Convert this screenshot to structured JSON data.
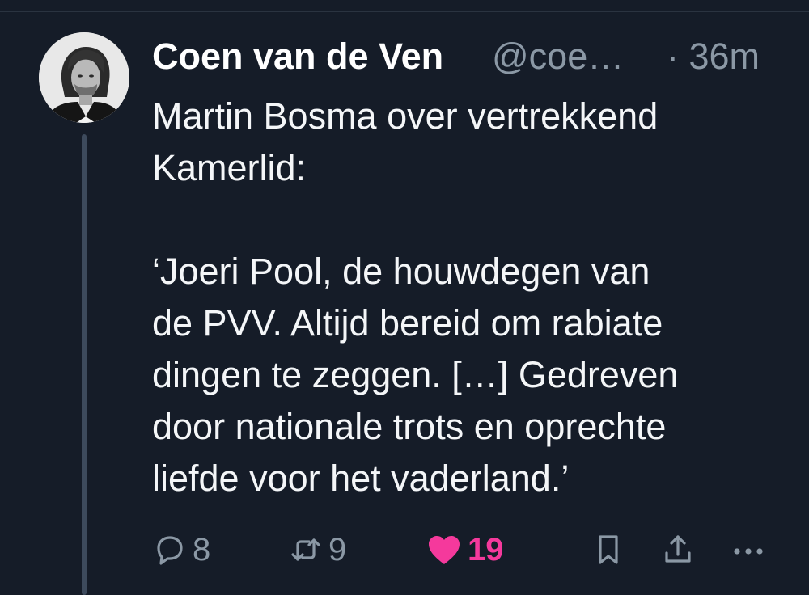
{
  "tweet": {
    "author_name": "Coen van de Ven",
    "author_handle": "@coe…",
    "time": "· 36m",
    "text_lines": [
      "Martin Bosma over vertrekkend",
      "Kamerlid:",
      "",
      "‘Joeri Pool, de houwdegen van",
      "de PVV. Altijd bereid om rabiate",
      "dingen te zeggen. […] Gedreven",
      "door nationale trots en oprechte",
      "liefde voor het vaderland.’"
    ],
    "actions": {
      "reply_count": "8",
      "retweet_count": "9",
      "like_count": "19"
    }
  },
  "colors": {
    "background": "#151c28",
    "muted": "#8b98a5",
    "like": "#f5399c",
    "thread_line": "#3d4a5c"
  },
  "icons": {
    "reply": "reply-icon",
    "retweet": "retweet-icon",
    "like": "heart-icon",
    "bookmark": "bookmark-icon",
    "share": "share-icon",
    "more": "more-icon"
  }
}
